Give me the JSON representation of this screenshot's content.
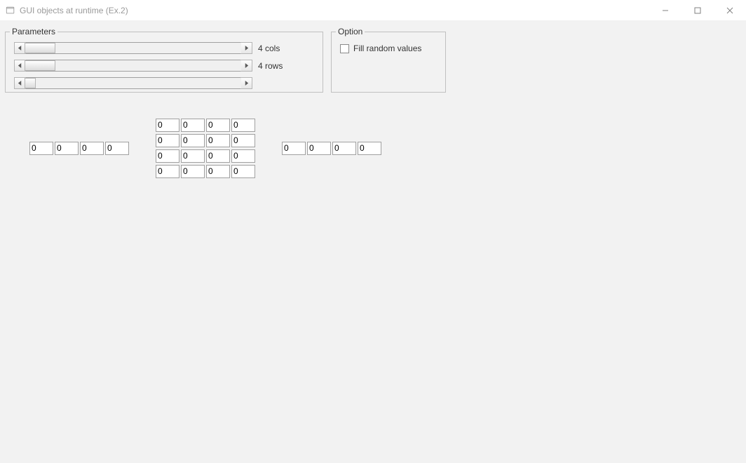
{
  "window": {
    "title": "GUI objects at runtime (Ex.2)"
  },
  "parameters": {
    "legend": "Parameters",
    "cols": {
      "label": "4 cols"
    },
    "rows": {
      "label": "4 rows"
    }
  },
  "option": {
    "legend": "Option",
    "fill_random": "Fill random values"
  },
  "vectorA": {
    "cols": 4,
    "rows": 1,
    "cells": [
      [
        "0",
        "0",
        "0",
        "0"
      ]
    ]
  },
  "matrix": {
    "cols": 4,
    "rows": 4,
    "cells": [
      [
        "0",
        "0",
        "0",
        "0"
      ],
      [
        "0",
        "0",
        "0",
        "0"
      ],
      [
        "0",
        "0",
        "0",
        "0"
      ],
      [
        "0",
        "0",
        "0",
        "0"
      ]
    ]
  },
  "vectorB": {
    "cols": 4,
    "rows": 1,
    "cells": [
      [
        "0",
        "0",
        "0",
        "0"
      ]
    ]
  }
}
